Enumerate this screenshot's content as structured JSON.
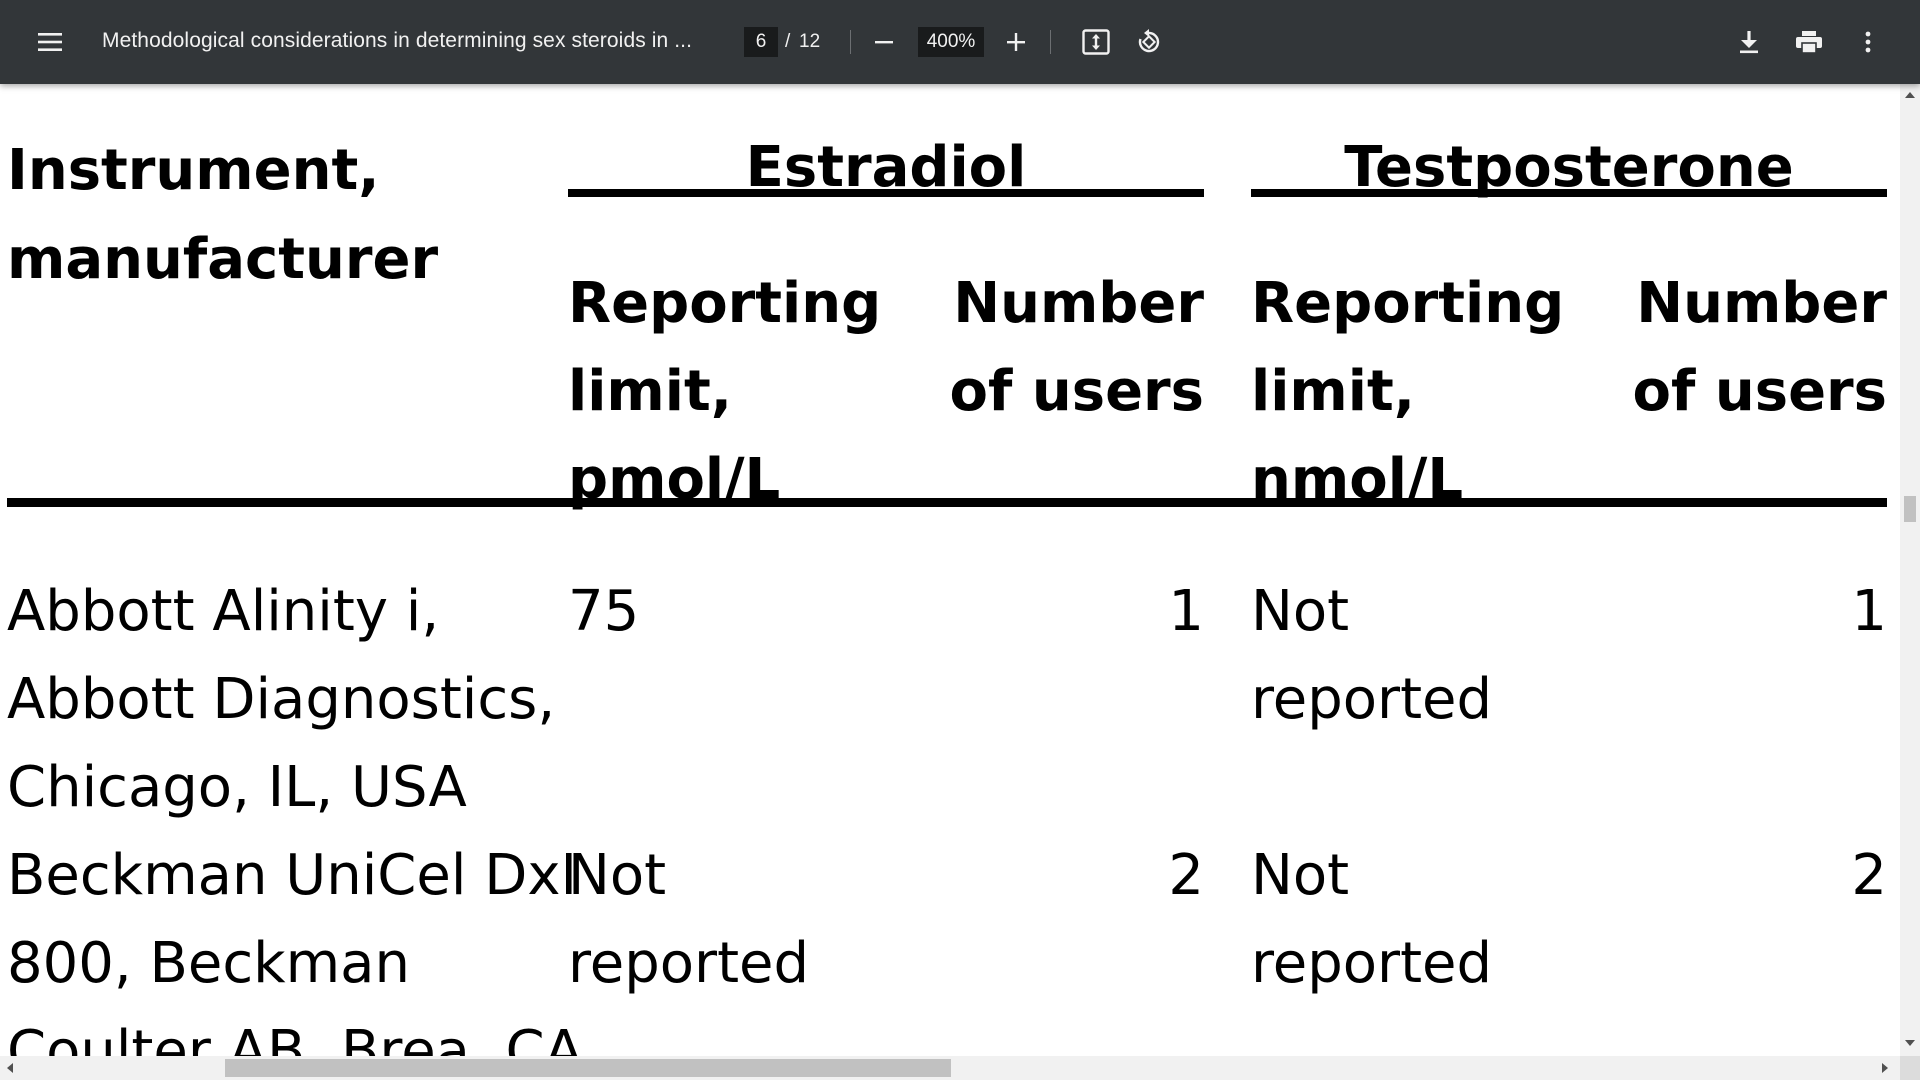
{
  "toolbar": {
    "title": "Methodological considerations in determining sex steroids in ...",
    "page_current": "6",
    "page_separator": "/",
    "page_total": "12",
    "zoom": "400%"
  },
  "icons": {
    "menu": "hamburger-menu-icon",
    "zoom_out": "minus-icon",
    "zoom_in": "plus-icon",
    "fit": "fit-to-page-icon",
    "rotate": "rotate-icon",
    "download": "download-icon",
    "print": "print-icon",
    "more": "more-vertical-icon"
  },
  "table": {
    "col_instrument_header_line1": "Instrument,",
    "col_instrument_header_line2": "manufacturer",
    "group_estradiol": "Estradiol",
    "group_testosterone": "Testposterone",
    "estradiol_limit_header": [
      "Reporting",
      "limit,",
      "pmol/L"
    ],
    "estradiol_users_header": [
      "Number",
      "of users"
    ],
    "testosterone_limit_header": [
      "Reporting",
      "limit,",
      "nmol/L"
    ],
    "testosterone_users_header": [
      "Number",
      "of users"
    ],
    "rows": [
      {
        "instrument": [
          "Abbott Alinity i,",
          "Abbott Diagnostics,",
          "Chicago, IL, USA"
        ],
        "estradiol_limit": [
          "75"
        ],
        "estradiol_users": "1",
        "testosterone_limit": [
          "Not",
          "reported"
        ],
        "testosterone_users": "1"
      },
      {
        "instrument": [
          "Beckman UniCel DxI",
          "800, Beckman",
          "Coulter AB, Brea, CA,"
        ],
        "estradiol_limit": [
          "Not",
          "reported"
        ],
        "estradiol_users": "2",
        "testosterone_limit": [
          "Not",
          "reported"
        ],
        "testosterone_users": "2"
      }
    ]
  }
}
